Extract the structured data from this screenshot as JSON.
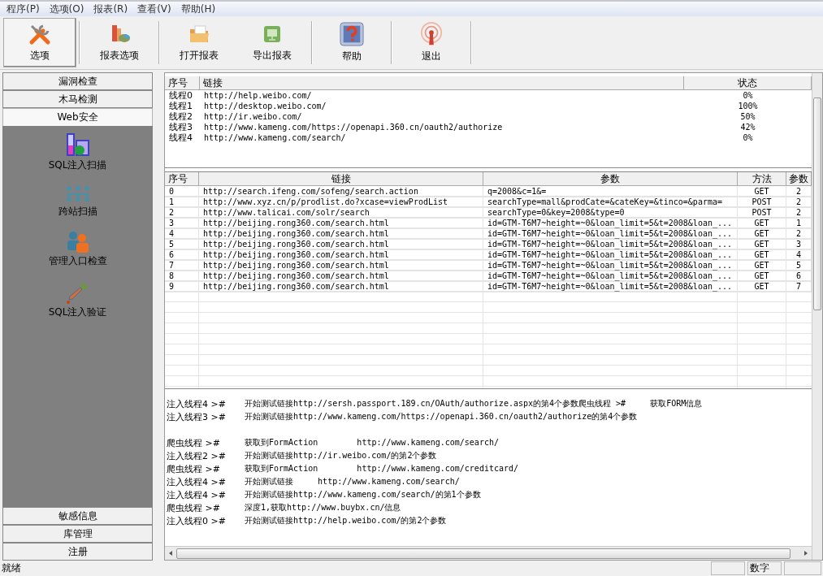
{
  "menu": [
    {
      "label": "程序(P)"
    },
    {
      "label": "选项(O)"
    },
    {
      "label": "报表(R)"
    },
    {
      "label": "查看(V)"
    },
    {
      "label": "帮助(H)"
    }
  ],
  "toolbar": [
    {
      "buttons": [
        {
          "label": "选项",
          "selected": true
        }
      ]
    },
    {
      "buttons": [
        {
          "label": "报表选项",
          "selected": false
        }
      ]
    },
    {
      "buttons": [
        {
          "label": "打开报表",
          "selected": false
        },
        {
          "label": "导出报表",
          "selected": false
        }
      ]
    },
    {
      "buttons": [
        {
          "label": "帮助",
          "selected": false
        }
      ]
    },
    {
      "buttons": [
        {
          "label": "退出",
          "selected": false
        }
      ]
    }
  ],
  "sidebar": {
    "sections": [
      {
        "label": "漏洞检查",
        "expanded": false
      },
      {
        "label": "木马检测",
        "expanded": false
      },
      {
        "label": "Web安全",
        "expanded": true,
        "items": [
          {
            "label": "SQL注入扫描"
          },
          {
            "label": "跨站扫描"
          },
          {
            "label": "管理入口检查"
          },
          {
            "label": "SQL注入验证"
          }
        ]
      },
      {
        "label": "敏感信息",
        "expanded": false
      },
      {
        "label": "库管理",
        "expanded": false
      },
      {
        "label": "注册",
        "expanded": false
      }
    ]
  },
  "threads_table": {
    "columns": [
      "序号",
      "链接",
      "状态"
    ],
    "rows": [
      [
        "线程0",
        "http://help.weibo.com/",
        "0%"
      ],
      [
        "线程1",
        "http://desktop.weibo.com/",
        "100%"
      ],
      [
        "线程2",
        "http://ir.weibo.com/",
        "50%"
      ],
      [
        "线程3",
        "http://www.kameng.com/https://openapi.360.cn/oauth2/authorize",
        "42%"
      ],
      [
        "线程4",
        "http://www.kameng.com/search/",
        "0%"
      ]
    ]
  },
  "params_table": {
    "columns": [
      "序号",
      "链接",
      "参数",
      "方法",
      "参数"
    ],
    "rows": [
      [
        "0",
        "http://search.ifeng.com/sofeng/search.action",
        "q=2008&c=1&=",
        "GET",
        "2"
      ],
      [
        "1",
        "http://www.xyz.cn/p/prodlist.do?xcase=viewProdList",
        "searchType=mall&prodCate=&cateKey=&tinco=&parma=",
        "POST",
        "2"
      ],
      [
        "2",
        "http://www.talicai.com/solr/search",
        "searchType=0&key=2008&type=0",
        "POST",
        "2"
      ],
      [
        "3",
        "http://beijing.rong360.com/search.html",
        "id=GTM-T6M7~height=~0&loan_limit=5&t=2008&loan_...",
        "GET",
        "1"
      ],
      [
        "4",
        "http://beijing.rong360.com/search.html",
        "id=GTM-T6M7~height=~0&loan_limit=5&t=2008&loan_...",
        "GET",
        "2"
      ],
      [
        "5",
        "http://beijing.rong360.com/search.html",
        "id=GTM-T6M7~height=~0&loan_limit=5&t=2008&loan_...",
        "GET",
        "3"
      ],
      [
        "6",
        "http://beijing.rong360.com/search.html",
        "id=GTM-T6M7~height=~0&loan_limit=5&t=2008&loan_...",
        "GET",
        "4"
      ],
      [
        "7",
        "http://beijing.rong360.com/search.html",
        "id=GTM-T6M7~height=~0&loan_limit=5&t=2008&loan_...",
        "GET",
        "5"
      ],
      [
        "8",
        "http://beijing.rong360.com/search.html",
        "id=GTM-T6M7~height=~0&loan_limit=5&t=2008&loan_...",
        "GET",
        "6"
      ],
      [
        "9",
        "http://beijing.rong360.com/search.html",
        "id=GTM-T6M7~height=~0&loan_limit=5&t=2008&loan_...",
        "GET",
        "7"
      ]
    ]
  },
  "log": [
    {
      "kind": "entry",
      "thread": "注入线程4 >#",
      "message": "开始测试链接http://sersh.passport.189.cn/OAuth/authorize.aspx的第4个参数爬虫线程 >#     获取FORM信息"
    },
    {
      "kind": "entry",
      "thread": "注入线程3 >#",
      "message": "开始测试链接http://www.kameng.com/https://openapi.360.cn/oauth2/authorize的第4个参数"
    },
    {
      "kind": "blank"
    },
    {
      "kind": "entry",
      "thread": "爬虫线程 >#",
      "message": "获取到FormAction        http://www.kameng.com/search/"
    },
    {
      "kind": "entry",
      "thread": "注入线程2 >#",
      "message": "开始测试链接http://ir.weibo.com/的第2个参数"
    },
    {
      "kind": "entry",
      "thread": "爬虫线程 >#",
      "message": "获取到FormAction        http://www.kameng.com/creditcard/"
    },
    {
      "kind": "entry",
      "thread": "注入线程4 >#",
      "message": "开始测试链接     http://www.kameng.com/search/"
    },
    {
      "kind": "entry",
      "thread": "注入线程4 >#",
      "message": "开始测试链接http://www.kameng.com/search/的第1个参数"
    },
    {
      "kind": "entry",
      "thread": "爬虫线程 >#",
      "message": "深度1,获取http://www.buybx.cn/信息"
    },
    {
      "kind": "entry",
      "thread": "注入线程0 >#",
      "message": "开始测试链接http://help.weibo.com/的第2个参数"
    }
  ],
  "status_bar": {
    "message": "就绪",
    "indicator": "数字"
  }
}
